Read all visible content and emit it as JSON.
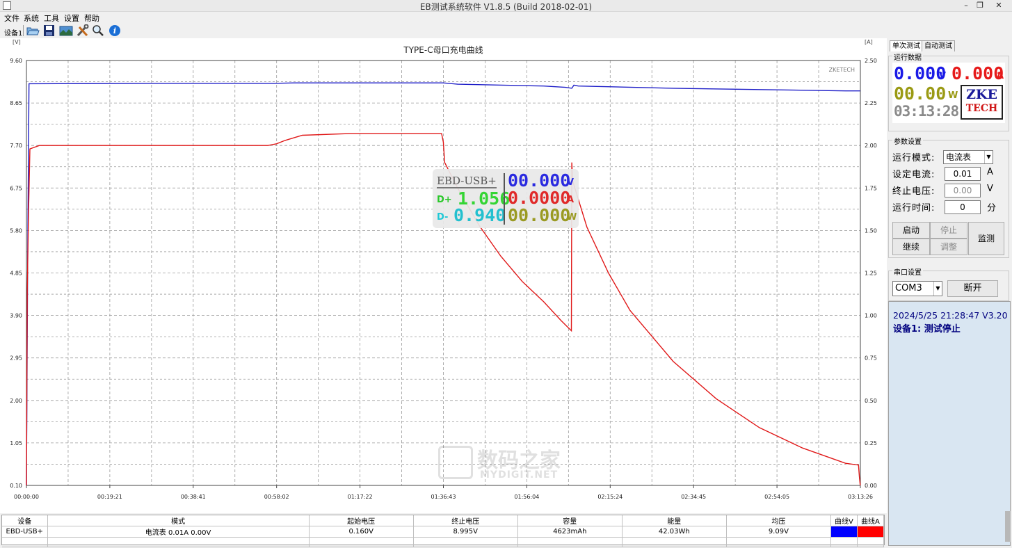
{
  "window": {
    "title": "EB测试系统软件 V1.8.5 (Build 2018-02-01)",
    "minimize": "–",
    "restore": "❐",
    "close": "✕"
  },
  "menu": [
    "文件",
    "系统",
    "工具",
    "设置",
    "帮助"
  ],
  "toolbar": {
    "device_label": "设备1",
    "buttons": [
      "open-folder-icon",
      "save-icon",
      "image-icon",
      "tools-icon",
      "zoom-icon",
      "info-icon"
    ]
  },
  "chart_data": {
    "type": "line",
    "title": "TYPE-C母口充电曲线",
    "watermark": "ZKETECH",
    "left_axis_unit": "[V]",
    "right_axis_unit": "[A]",
    "ylim_left": [
      0.1,
      9.6
    ],
    "ylim_right": [
      0.0,
      2.5
    ],
    "y_ticks_left": [
      "9.60",
      "8.65",
      "7.70",
      "6.75",
      "5.80",
      "4.85",
      "3.90",
      "2.95",
      "2.00",
      "1.05",
      "0.10"
    ],
    "y_ticks_right": [
      "2.50",
      "2.25",
      "2.00",
      "1.75",
      "1.50",
      "1.25",
      "1.00",
      "0.75",
      "0.50",
      "0.25",
      "0.00"
    ],
    "x_ticks": [
      "00:00:00",
      "00:19:21",
      "00:38:41",
      "00:58:02",
      "01:17:22",
      "01:36:43",
      "01:56:04",
      "02:15:24",
      "02:34:45",
      "02:54:05",
      "03:13:26"
    ],
    "xlim_minutes": [
      0,
      193.43
    ],
    "grid": true,
    "series": [
      {
        "axis": "left",
        "color": "#1f1fc8",
        "x_minutes": [
          0,
          0.3,
          0.6,
          30,
          58,
          62,
          96.7,
          100,
          120,
          125,
          126.5,
          127,
          128,
          150,
          170,
          190,
          193.4
        ],
        "values": [
          0.1,
          5.5,
          9.08,
          9.09,
          9.09,
          9.1,
          9.1,
          9.07,
          9.03,
          9.0,
          8.98,
          9.05,
          9.03,
          8.98,
          8.95,
          8.92,
          8.92
        ]
      },
      {
        "axis": "right",
        "color": "#e01818",
        "x_minutes": [
          0,
          0.2,
          0.5,
          0.8,
          3,
          5,
          15,
          30,
          45,
          56,
          58,
          60,
          64,
          75,
          90,
          96,
          96.3,
          96.7,
          97,
          100,
          105,
          110,
          115,
          120,
          124,
          126.4,
          126.5,
          126.7,
          130,
          135,
          140,
          150,
          160,
          170,
          180,
          190,
          193.0,
          193.2,
          193.4
        ],
        "values": [
          0.0,
          1.15,
          1.62,
          1.98,
          2.0,
          2.0,
          2.0,
          2.0,
          2.0,
          2.0,
          2.01,
          2.03,
          2.06,
          2.07,
          2.07,
          2.07,
          2.07,
          2.02,
          1.9,
          1.75,
          1.53,
          1.35,
          1.2,
          1.08,
          0.97,
          0.91,
          1.9,
          1.79,
          1.52,
          1.25,
          1.03,
          0.73,
          0.51,
          0.34,
          0.22,
          0.13,
          0.12,
          0.05,
          0.0
        ]
      }
    ]
  },
  "ebd_overlay": {
    "device": "EBD-USB+",
    "dplus_label": "D+",
    "dplus_value": "1.056",
    "dminus_label": "D-",
    "dminus_value": "0.940",
    "voltage": "00.000",
    "voltage_unit": "V",
    "current": "0.0000",
    "current_unit": "A",
    "power": "00.000",
    "power_unit": "W"
  },
  "site_watermark": {
    "cn": "数码之家",
    "en": "MYDIGIT.NET"
  },
  "table": {
    "headers": [
      "设备",
      "模式",
      "起始电压",
      "终止电压",
      "容量",
      "能量",
      "均压",
      "曲线V",
      "曲线A"
    ],
    "rows": [
      {
        "device": "EBD-USB+",
        "mode": "电流表  0.01A  0.00V",
        "start_v": "0.160V",
        "end_v": "8.995V",
        "capacity": "4623mAh",
        "energy": "42.03Wh",
        "avg_v": "9.09V",
        "curve_v_color": "#0000ff",
        "curve_a_color": "#ff0000"
      }
    ]
  },
  "panel": {
    "tabs": [
      "单次测试",
      "自动测试"
    ],
    "running_data": {
      "title": "运行数据",
      "voltage": "0.000",
      "voltage_unit": "V",
      "current": "0.000",
      "current_unit": "A",
      "power": "00.00",
      "power_unit": "W",
      "time": "03:13:28",
      "logo_top": "ZKE",
      "logo_bottom": "TECH"
    },
    "params": {
      "title": "参数设置",
      "mode_label": "运行模式:",
      "mode_value": "电流表",
      "current_label": "设定电流:",
      "current_value": "0.01",
      "current_unit": "A",
      "stopv_label": "终止电压:",
      "stopv_value": "0.00",
      "stopv_unit": "V",
      "time_label": "运行时间:",
      "time_value": "0",
      "time_unit": "分",
      "btn_start": "启动",
      "btn_stop": "停止",
      "btn_continue": "继续",
      "btn_adjust": "调整",
      "btn_monitor": "监测"
    },
    "serial": {
      "title": "串口设置",
      "port": "COM3",
      "disconnect": "断开"
    },
    "log": {
      "line1": "2024/5/25 21:28:47  V3.20",
      "line2": "设备1: 测试停止"
    }
  }
}
